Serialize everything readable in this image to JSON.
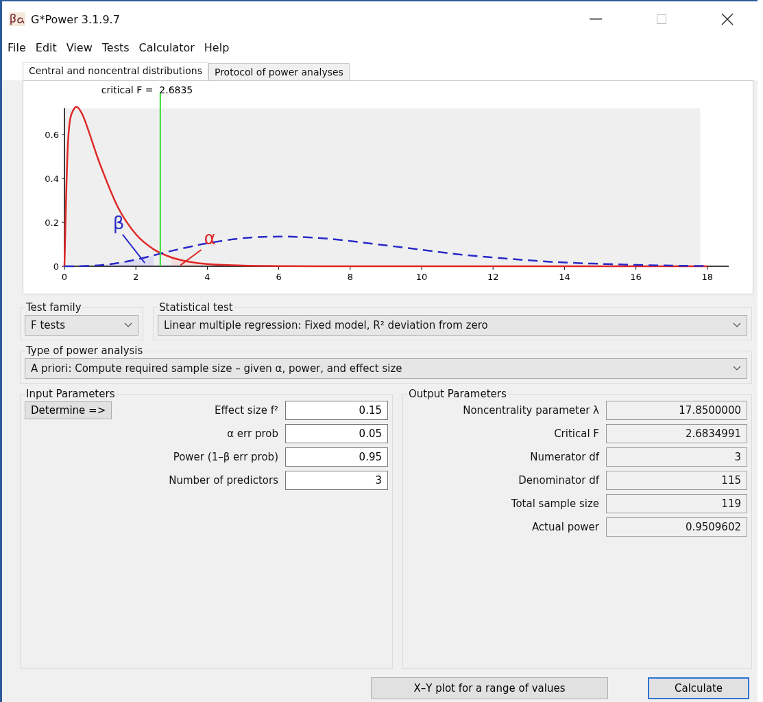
{
  "window": {
    "title": "G*Power 3.1.9.7"
  },
  "menu": [
    "File",
    "Edit",
    "View",
    "Tests",
    "Calculator",
    "Help"
  ],
  "tabs": [
    {
      "label": "Central and noncentral distributions",
      "selected": true
    },
    {
      "label": "Protocol of power analyses",
      "selected": false
    }
  ],
  "plot": {
    "chart_data": {
      "type": "line",
      "x": [
        0,
        0.1,
        0.25,
        0.5,
        1,
        1.5,
        2,
        2.5,
        3,
        3.5,
        4,
        5,
        6,
        7,
        8,
        9,
        10,
        11,
        12,
        13,
        14,
        15,
        16,
        17,
        18
      ],
      "xlim": [
        0,
        18.6
      ],
      "ylim": [
        0,
        0.72
      ],
      "xticks": [
        0,
        2,
        4,
        6,
        8,
        10,
        12,
        14,
        16,
        18
      ],
      "yticks": [
        0,
        0.2,
        0.4,
        0.6
      ],
      "series": [
        {
          "color": "#e02828",
          "line_style": "solid",
          "values": [
            0,
            0.565,
            0.712,
            0.692,
            0.463,
            0.268,
            0.146,
            0.077,
            0.04,
            0.02,
            0.01,
            0.003,
            0.001,
            0,
            0,
            0,
            0,
            0,
            0,
            0,
            0,
            0,
            0,
            0,
            0
          ]
        },
        {
          "color": "#2a2ac8",
          "line_style": "dashed",
          "values": [
            0,
            0,
            0,
            0.001,
            0.005,
            0.015,
            0.03,
            0.05,
            0.07,
            0.088,
            0.105,
            0.128,
            0.135,
            0.13,
            0.115,
            0.095,
            0.075,
            0.055,
            0.04,
            0.027,
            0.017,
            0.011,
            0.006,
            0.003,
            0.001
          ]
        }
      ],
      "ref_lines": [
        {
          "axis": "x",
          "value": 2.6835,
          "label": "critical F =  2.6835",
          "color": "#33dd33"
        }
      ]
    },
    "beta_label": "β",
    "alpha_label": "α"
  },
  "test_family": {
    "label": "Test family",
    "value": "F tests"
  },
  "statistical_test": {
    "label": "Statistical test",
    "value": "Linear multiple regression: Fixed model, R² deviation from zero"
  },
  "power_analysis_type": {
    "label": "Type of power analysis",
    "value": "A priori: Compute required sample size – given α, power, and effect size"
  },
  "input_parameters": {
    "title": "Input Parameters",
    "determine_button": "Determine =>",
    "fields": [
      {
        "label": "Effect size f²",
        "value": "0.15"
      },
      {
        "label": "α err prob",
        "value": "0.05"
      },
      {
        "label": "Power (1–β err prob)",
        "value": "0.95"
      },
      {
        "label": "Number of predictors",
        "value": "3"
      }
    ]
  },
  "output_parameters": {
    "title": "Output Parameters",
    "fields": [
      {
        "label": "Noncentrality parameter λ",
        "value": "17.8500000"
      },
      {
        "label": "Critical F",
        "value": "2.6834991"
      },
      {
        "label": "Numerator df",
        "value": "3"
      },
      {
        "label": "Denominator df",
        "value": "115"
      },
      {
        "label": "Total sample size",
        "value": "119"
      },
      {
        "label": "Actual power",
        "value": "0.9509602"
      }
    ]
  },
  "buttons": [
    "X–Y plot for a range of values",
    "Calculate"
  ]
}
